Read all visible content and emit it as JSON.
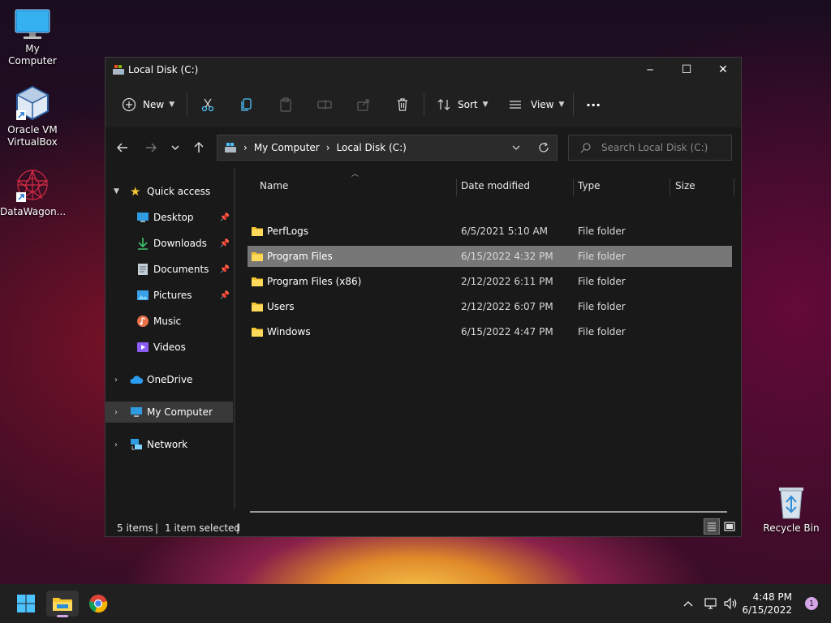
{
  "desktop": {
    "icons": [
      {
        "label": "My Computer",
        "icon": "monitor-icon"
      },
      {
        "label": "Oracle VM VirtualBox",
        "icon": "virtualbox-icon"
      },
      {
        "label": "DataWagon...",
        "icon": "datawagon-icon"
      },
      {
        "label": "Recycle Bin",
        "icon": "recycle-bin-icon"
      }
    ]
  },
  "window": {
    "title": "Local Disk (C:)",
    "controls": {
      "minimize": "─",
      "maximize": "☐",
      "close": "✕"
    }
  },
  "toolbar": {
    "new_label": "New",
    "sort_label": "Sort",
    "view_label": "View",
    "more_label": "···"
  },
  "address": {
    "crumbs": [
      "My Computer",
      "Local Disk (C:)"
    ],
    "separator": "›",
    "search_placeholder": "Search Local Disk (C:)"
  },
  "nav": {
    "quick_access": "Quick access",
    "items": [
      {
        "label": "Desktop",
        "pinned": true
      },
      {
        "label": "Downloads",
        "pinned": true
      },
      {
        "label": "Documents",
        "pinned": true
      },
      {
        "label": "Pictures",
        "pinned": true
      },
      {
        "label": "Music",
        "pinned": false
      },
      {
        "label": "Videos",
        "pinned": false
      }
    ],
    "onedrive": "OneDrive",
    "my_computer": "My Computer",
    "network": "Network"
  },
  "columns": {
    "name": "Name",
    "date": "Date modified",
    "type": "Type",
    "size": "Size"
  },
  "files": [
    {
      "name": "PerfLogs",
      "date": "6/5/2021 5:10 AM",
      "type": "File folder",
      "selected": false
    },
    {
      "name": "Program Files",
      "date": "6/15/2022 4:32 PM",
      "type": "File folder",
      "selected": true
    },
    {
      "name": "Program Files (x86)",
      "date": "2/12/2022 6:11 PM",
      "type": "File folder",
      "selected": false
    },
    {
      "name": "Users",
      "date": "2/12/2022 6:07 PM",
      "type": "File folder",
      "selected": false
    },
    {
      "name": "Windows",
      "date": "6/15/2022 4:47 PM",
      "type": "File folder",
      "selected": false
    }
  ],
  "status": {
    "items": "5 items",
    "selected": "1 item selected",
    "divider": "|"
  },
  "taskbar": {
    "time": "4:48 PM",
    "date": "6/15/2022",
    "notifications": "1"
  },
  "colors": {
    "folder": "#f4c531",
    "accent": "#4cc2ff",
    "selection": "#777777"
  }
}
